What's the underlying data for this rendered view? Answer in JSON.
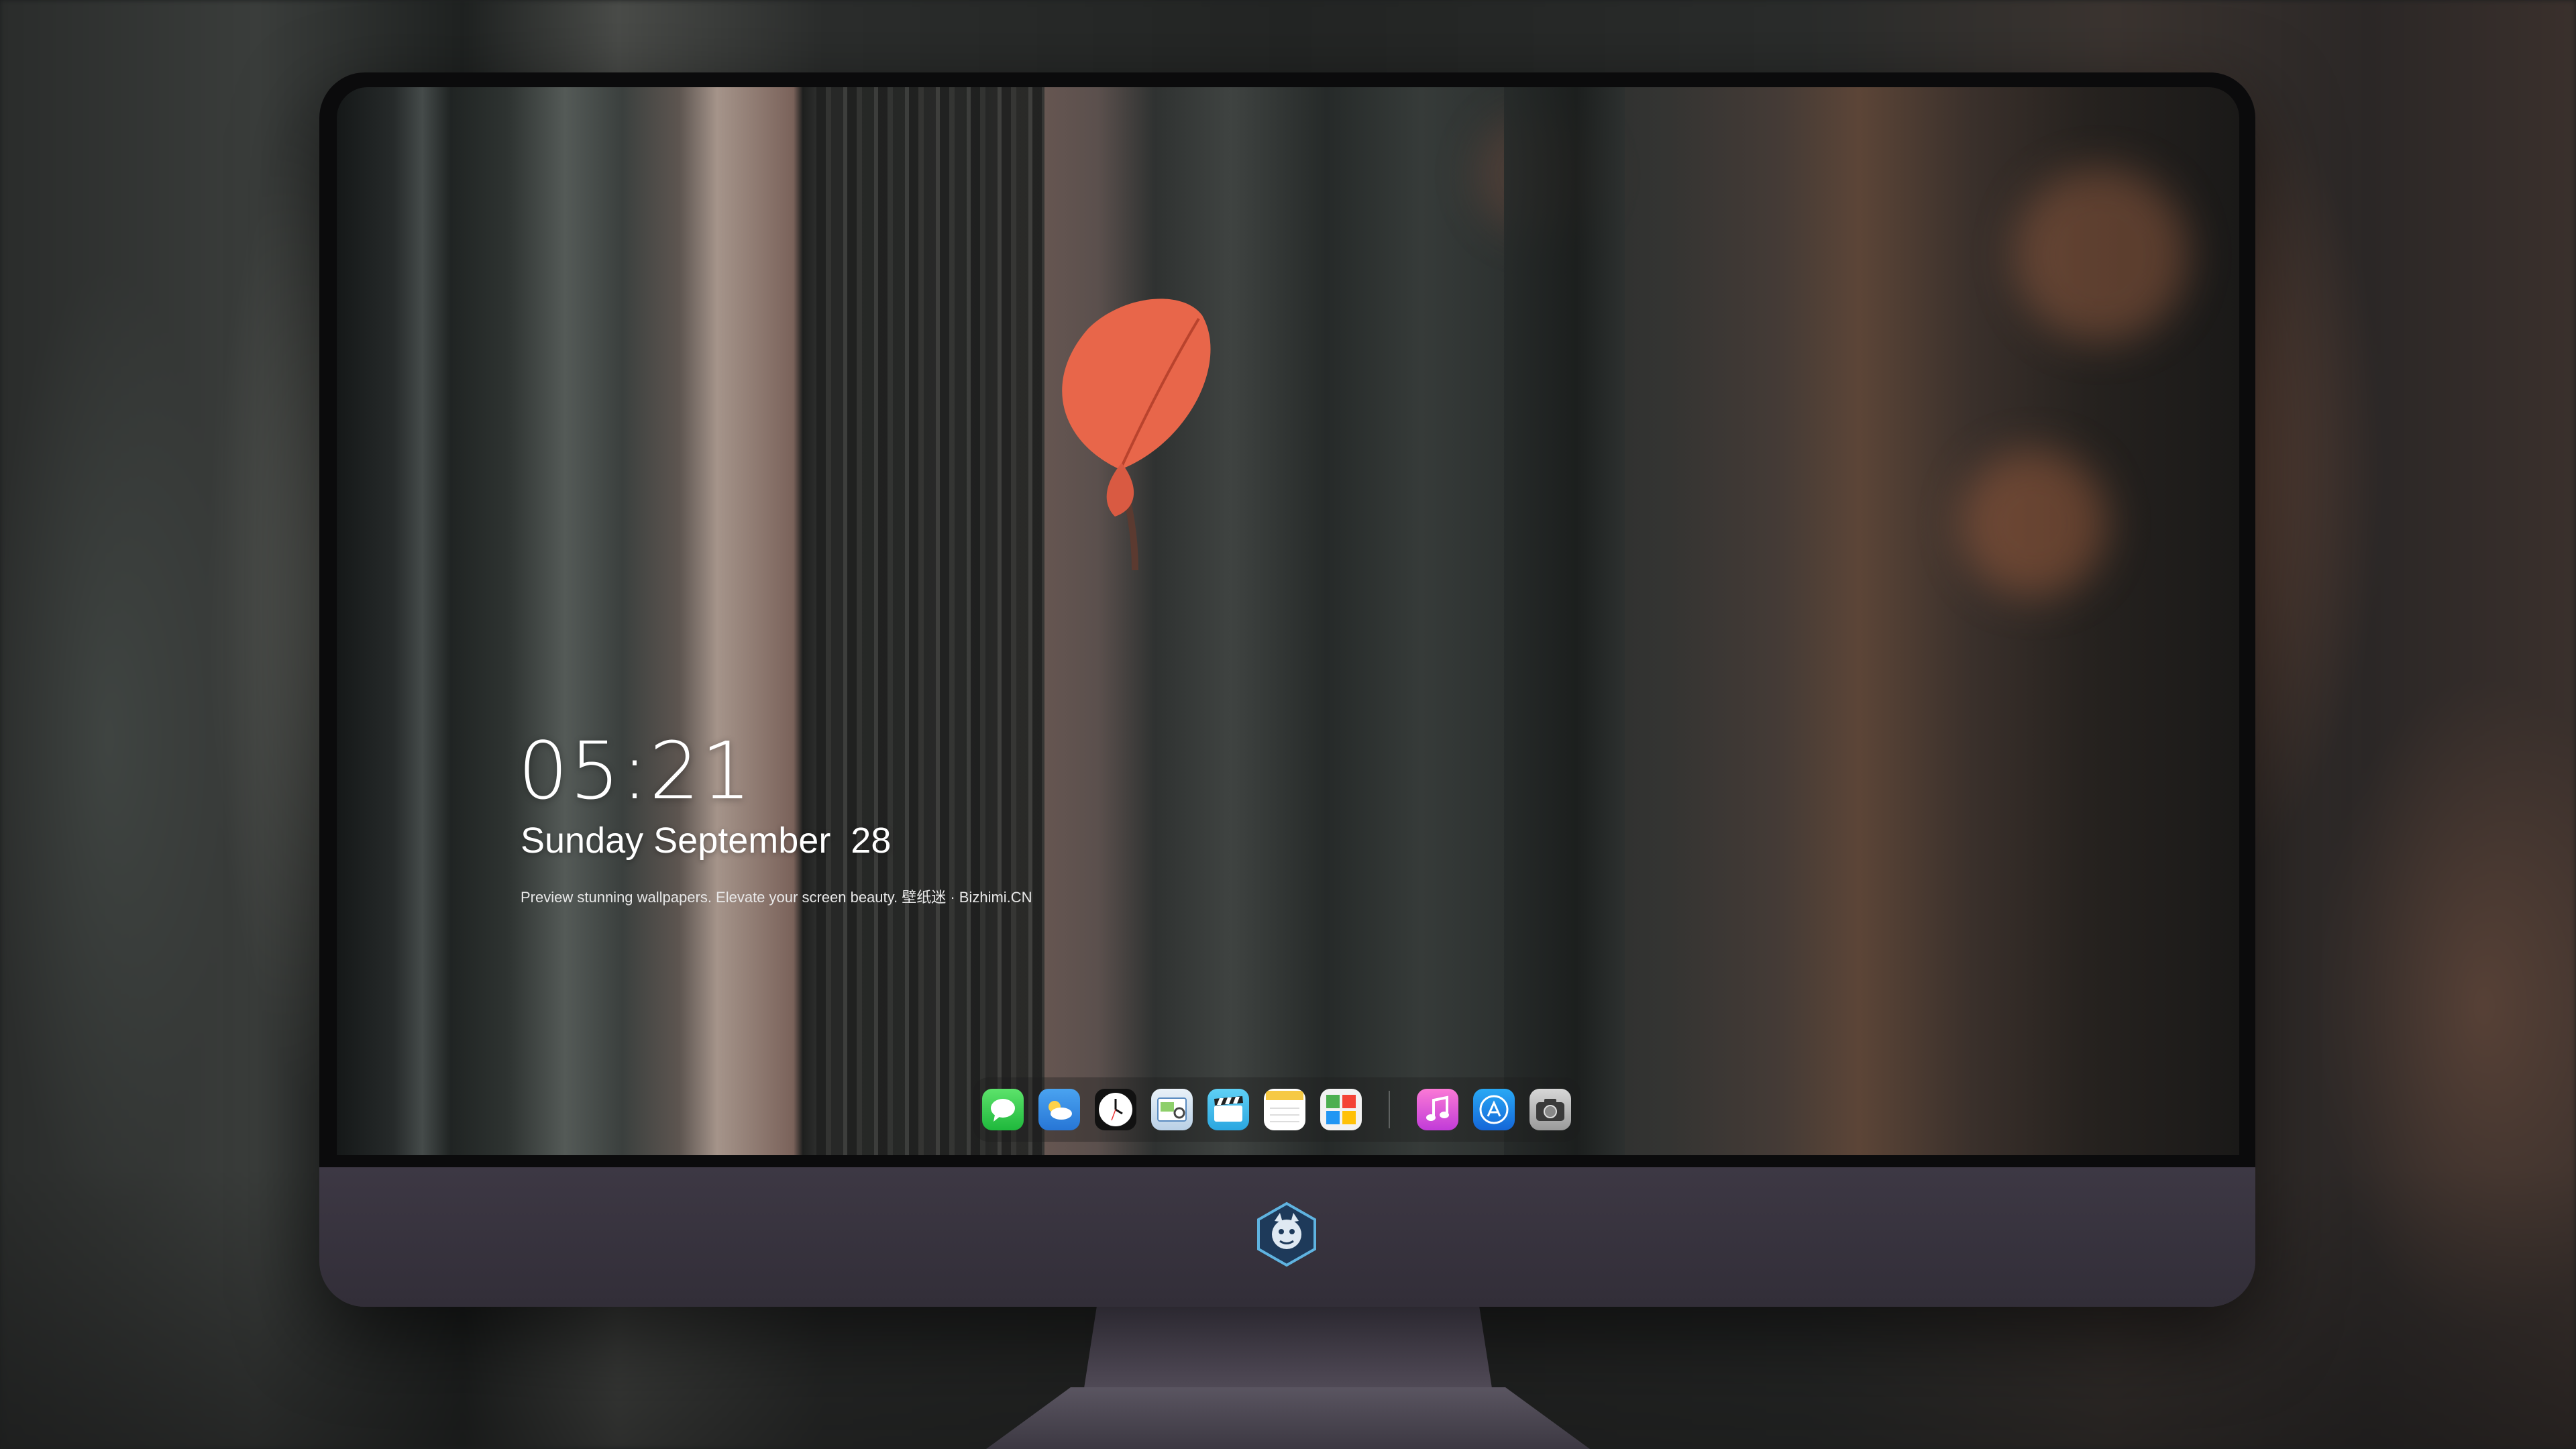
{
  "lockscreen": {
    "time": "05:21",
    "date": "Sunday September  28",
    "tagline": "Preview stunning wallpapers. Elevate your screen beauty. 壁纸迷 · Bizhimi.CN"
  },
  "dock": {
    "apps": [
      "messages-icon",
      "weather-icon",
      "clock-icon",
      "preview-icon",
      "clips-icon",
      "notes-icon",
      "photo-booth-icon"
    ],
    "apps_right": [
      "music-icon",
      "app-store-icon",
      "screenshot-icon"
    ]
  },
  "colors": {
    "leaf": "#e8664a",
    "monitor_body": "#2f2c33",
    "messages": "#2fc94f",
    "weather": "#3d8fe8",
    "music": "#f15bc4",
    "app_store": "#1a8cf0"
  }
}
